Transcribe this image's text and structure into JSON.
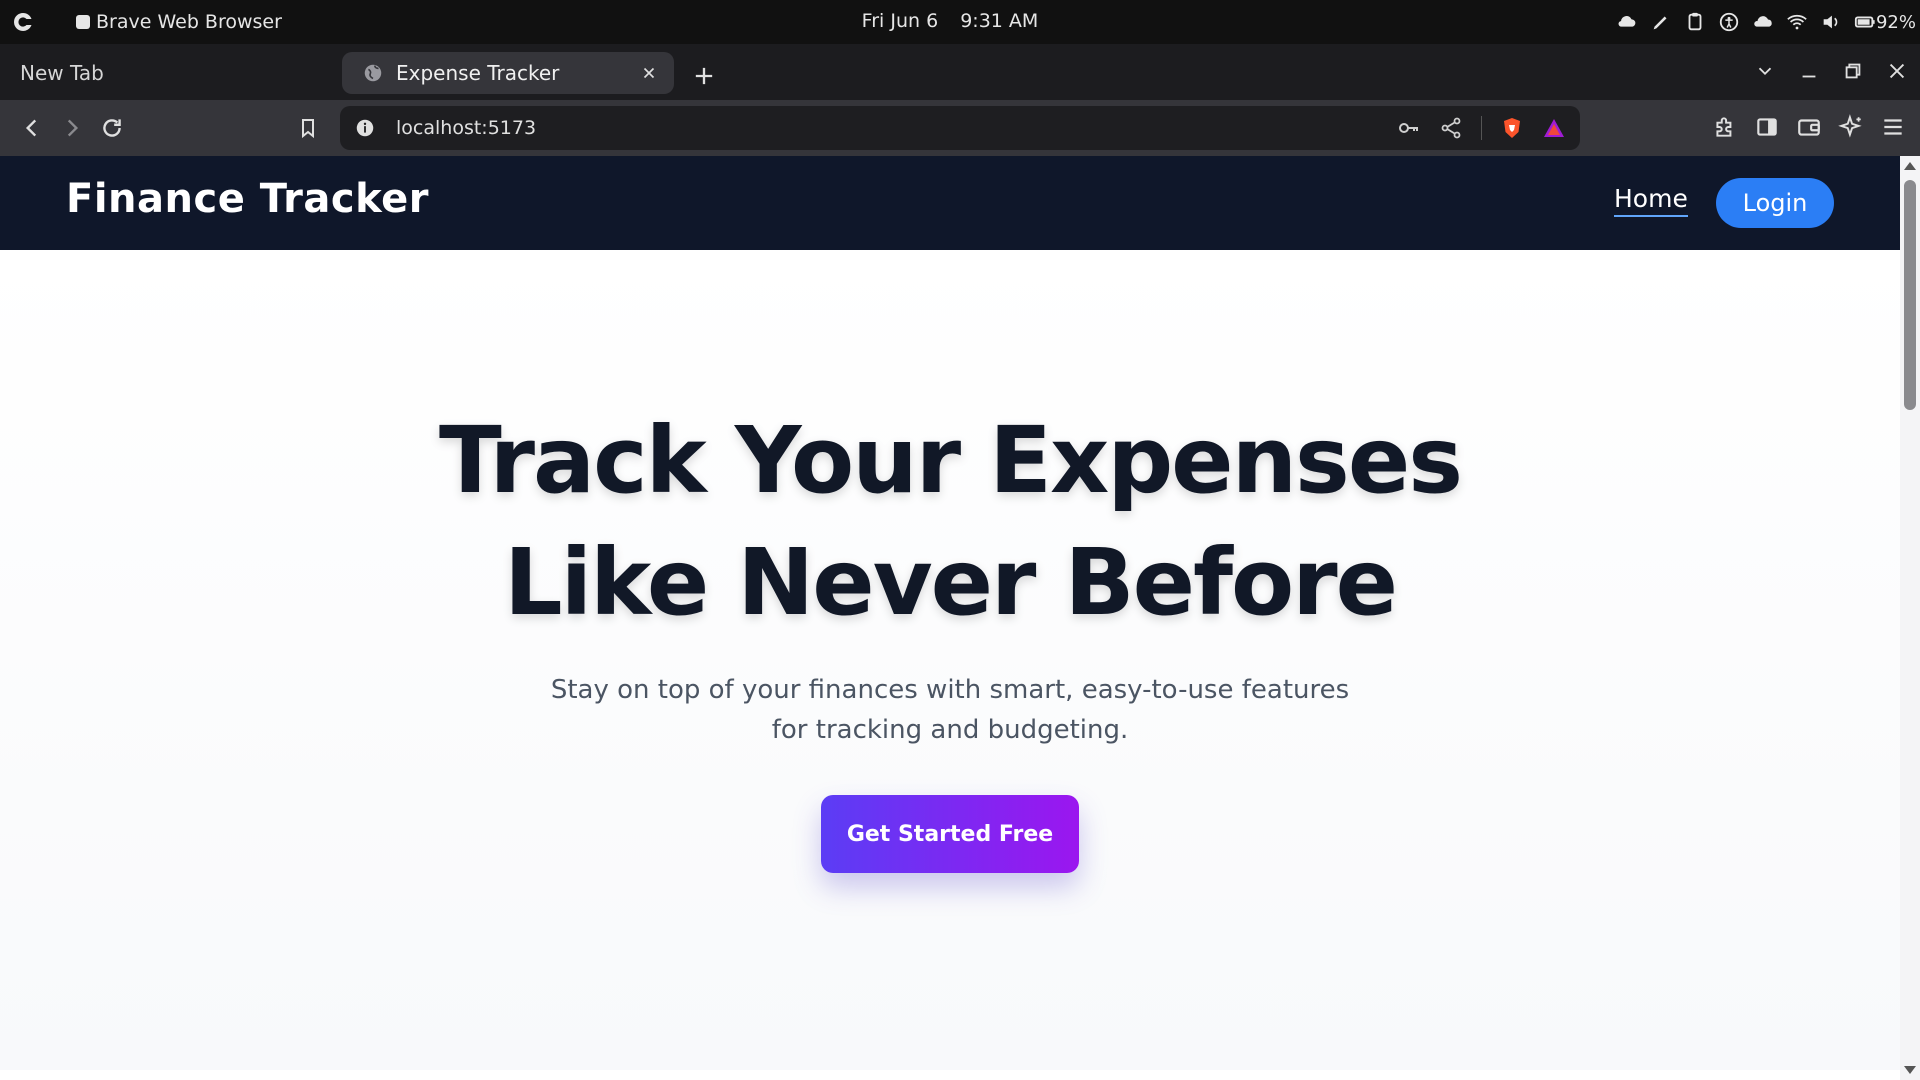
{
  "os": {
    "app_name": "Brave Web Browser",
    "date": "Fri Jun 6",
    "time": "9:31 AM",
    "battery": "92%"
  },
  "browser": {
    "tabs": [
      {
        "title": "New Tab",
        "active": false
      },
      {
        "title": "Expense Tracker",
        "active": true
      }
    ],
    "url": "localhost:5173"
  },
  "site": {
    "brand": "Finance Tracker",
    "nav": {
      "home": "Home",
      "login": "Login"
    },
    "hero": {
      "title_line1": "Track Your Expenses",
      "title_line2": "Like Never Before",
      "subtitle": "Stay on top of your finances with smart, easy-to-use features for tracking and budgeting.",
      "cta": "Get Started Free"
    }
  },
  "colors": {
    "header_bg": "#0f172a",
    "login_button": "#2b7ef5",
    "cta_gradient_start": "#5b3df5",
    "cta_gradient_end": "#9b16ef",
    "brave_orange": "#fb542b"
  }
}
